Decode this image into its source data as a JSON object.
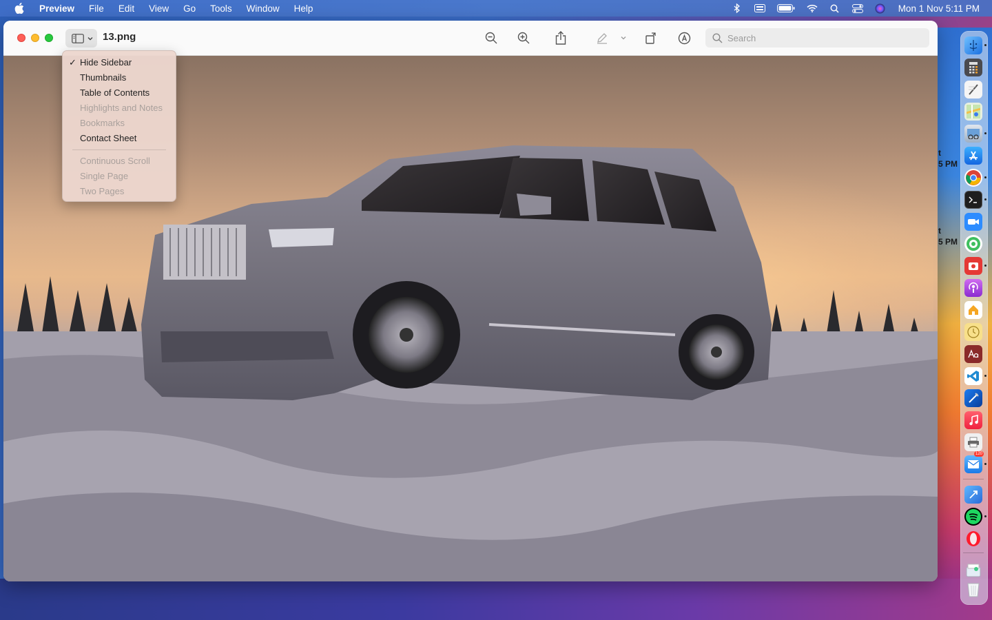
{
  "menubar": {
    "app_name": "Preview",
    "items": [
      "File",
      "Edit",
      "View",
      "Go",
      "Tools",
      "Window",
      "Help"
    ],
    "clock": "Mon 1 Nov  5:11 PM"
  },
  "window": {
    "title": "13.png",
    "search_placeholder": "Search"
  },
  "sidebar_menu": {
    "items": [
      {
        "label": "Hide Sidebar",
        "checked": true,
        "enabled": true
      },
      {
        "label": "Thumbnails",
        "enabled": true
      },
      {
        "label": "Table of Contents",
        "enabled": true
      },
      {
        "label": "Highlights and Notes",
        "enabled": false
      },
      {
        "label": "Bookmarks",
        "enabled": false
      },
      {
        "label": "Contact Sheet",
        "enabled": true
      }
    ],
    "view_items": [
      {
        "label": "Continuous Scroll",
        "enabled": false
      },
      {
        "label": "Single Page",
        "enabled": false
      },
      {
        "label": "Two Pages",
        "enabled": false
      }
    ],
    "check_glyph": "✓"
  },
  "background_text": {
    "line1a": "t",
    "line1b": "5 PM",
    "line2a": "t",
    "line2b": "5 PM"
  },
  "dock": {
    "mail_badge": "120"
  },
  "colors": {
    "close": "#fe5f57",
    "minimize": "#febc2e",
    "maximize": "#28c840",
    "menu_bg": "#ecd6ce"
  }
}
